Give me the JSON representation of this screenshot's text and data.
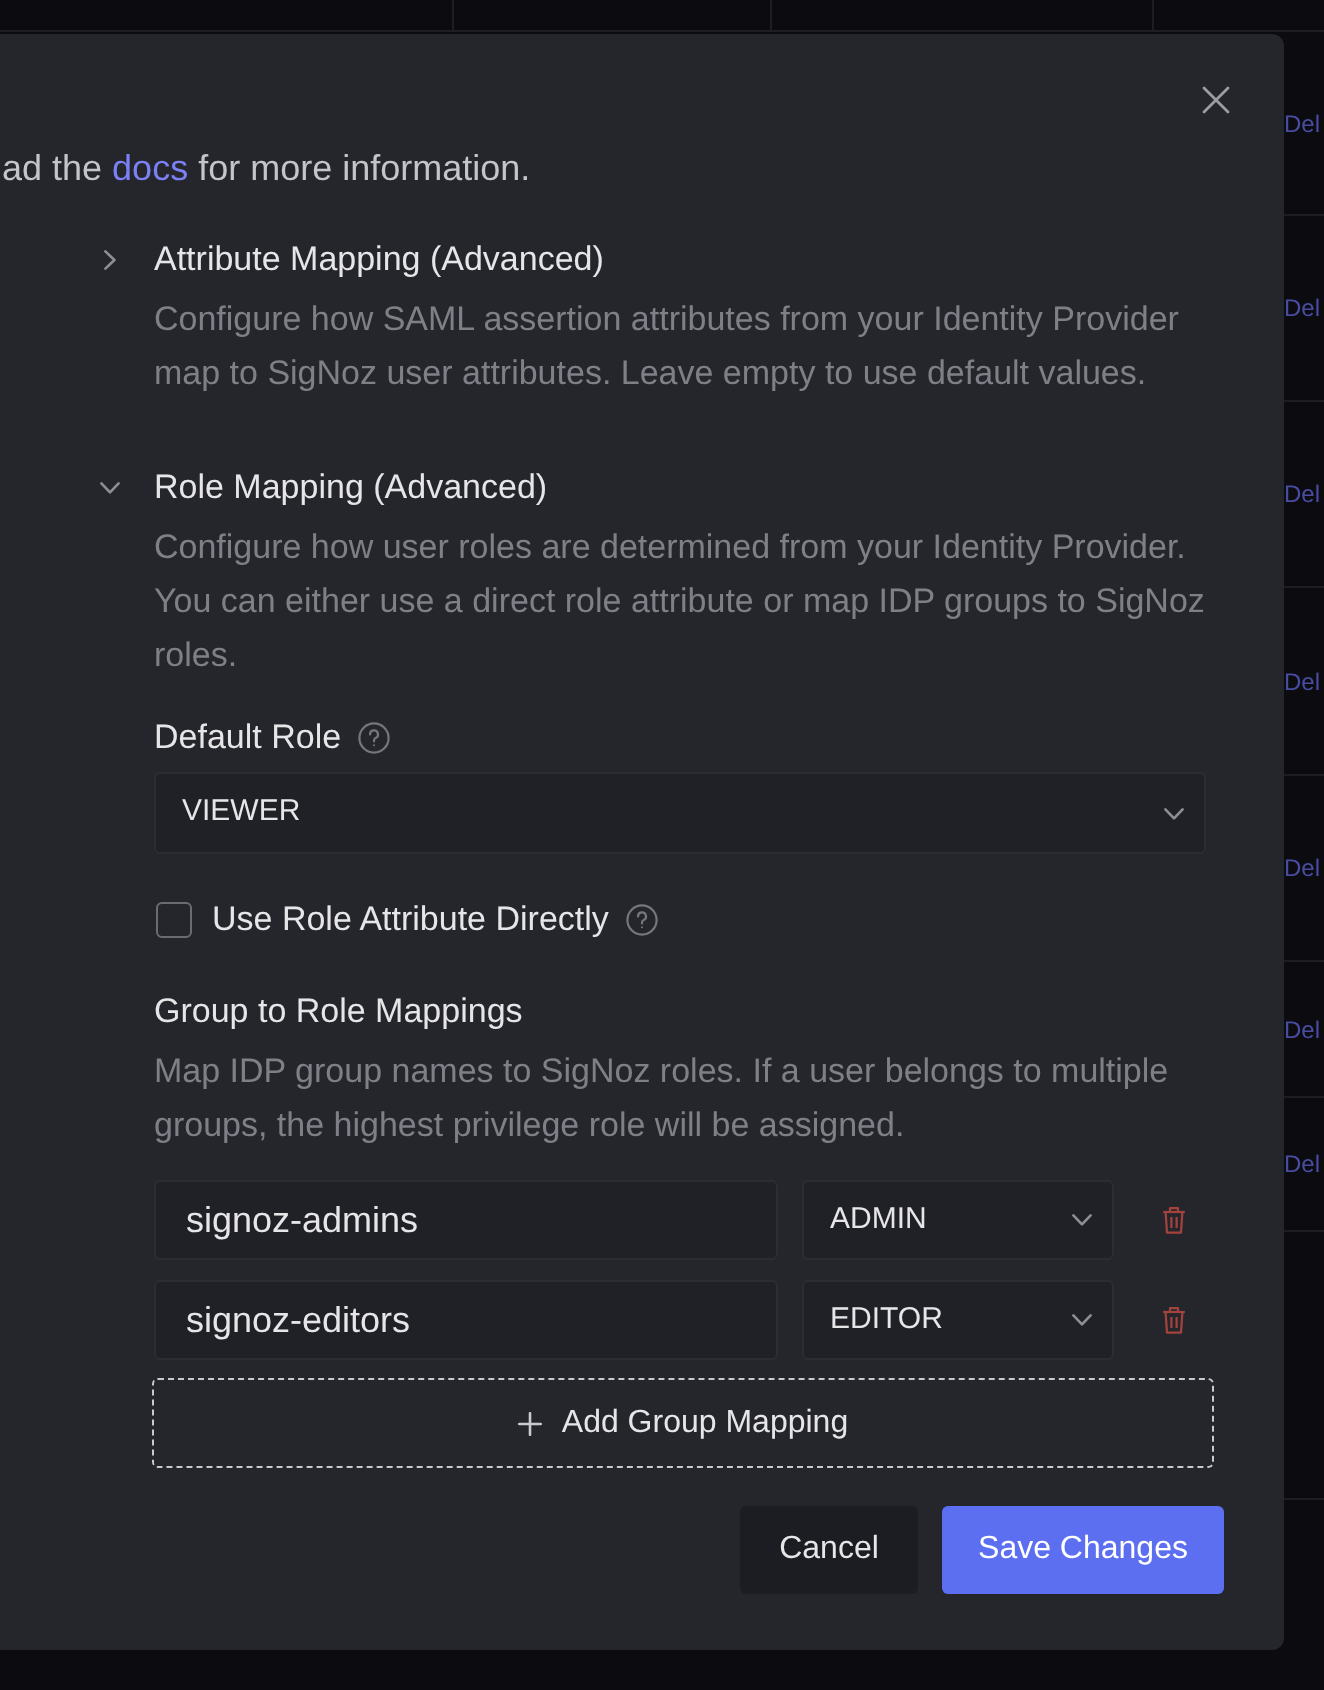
{
  "background_table": {
    "row_actions": [
      {
        "text": "Del"
      },
      {
        "text": "Del"
      },
      {
        "text": "Del"
      },
      {
        "text": "Del"
      },
      {
        "text": "Del"
      },
      {
        "text": "Del"
      },
      {
        "text": "Del"
      }
    ]
  },
  "dialog": {
    "intro": {
      "before": "ad the ",
      "link": "docs",
      "after": " for more information."
    },
    "sections": [
      {
        "title": "Attribute Mapping (Advanced)",
        "expanded": false,
        "description": "Configure how SAML assertion attributes from your Identity Provider map to SigNoz user attributes. Leave empty to use default values."
      },
      {
        "title": "Role Mapping (Advanced)",
        "expanded": true,
        "description": "Configure how user roles are determined from your Identity Provider. You can either use a direct role attribute or map IDP groups to SigNoz roles.",
        "default_role": {
          "label": "Default Role",
          "value": "VIEWER"
        },
        "use_role_attribute": {
          "label": "Use Role Attribute Directly",
          "checked": false
        },
        "group_mappings": {
          "title": "Group to Role Mappings",
          "description": "Map IDP group names to SigNoz roles. If a user belongs to multiple groups, the highest privilege role will be assigned.",
          "rows": [
            {
              "group": "signoz-admins",
              "role": "ADMIN"
            },
            {
              "group": "signoz-editors",
              "role": "EDITOR"
            }
          ],
          "add_button": "Add Group Mapping"
        }
      }
    ],
    "buttons": [
      {
        "label": "Cancel",
        "kind": "secondary"
      },
      {
        "label": "Save Changes",
        "kind": "primary"
      }
    ]
  }
}
